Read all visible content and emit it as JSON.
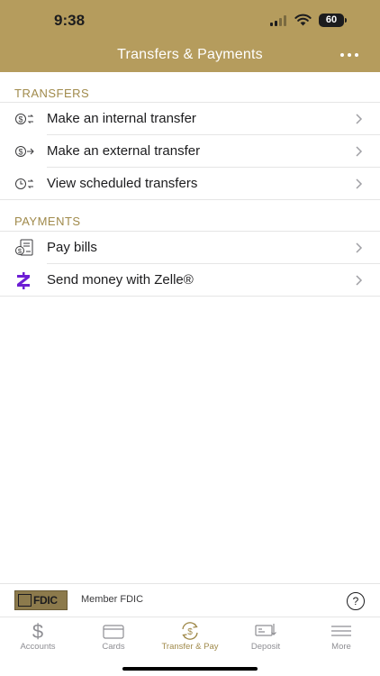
{
  "status_bar": {
    "time": "9:38",
    "battery": "60"
  },
  "header": {
    "title": "Transfers & Payments",
    "accent": "#b59c5d"
  },
  "sections": {
    "transfers": {
      "title": "TRANSFERS",
      "items": [
        {
          "label": "Make an internal transfer",
          "icon": "internal-transfer-icon"
        },
        {
          "label": "Make an external transfer",
          "icon": "external-transfer-icon"
        },
        {
          "label": "View scheduled transfers",
          "icon": "scheduled-transfer-icon"
        }
      ]
    },
    "payments": {
      "title": "PAYMENTS",
      "items": [
        {
          "label": "Pay bills",
          "icon": "bill-pay-icon"
        },
        {
          "label": "Send money with Zelle®",
          "icon": "zelle-icon"
        }
      ]
    }
  },
  "footer": {
    "fdic_logo": "FDIC",
    "member_text": "Member FDIC",
    "help": "?"
  },
  "tabbar": {
    "tabs": [
      {
        "label": "Accounts",
        "icon": "dollar-icon"
      },
      {
        "label": "Cards",
        "icon": "card-icon"
      },
      {
        "label": "Transfer & Pay",
        "icon": "transfer-pay-icon",
        "active": true
      },
      {
        "label": "Deposit",
        "icon": "deposit-icon"
      },
      {
        "label": "More",
        "icon": "menu-icon"
      }
    ],
    "active_color": "#a08a4b",
    "inactive_color": "#8e8e93"
  },
  "colors": {
    "zelle": "#6d1ed4",
    "section_header": "#a08a4b"
  }
}
